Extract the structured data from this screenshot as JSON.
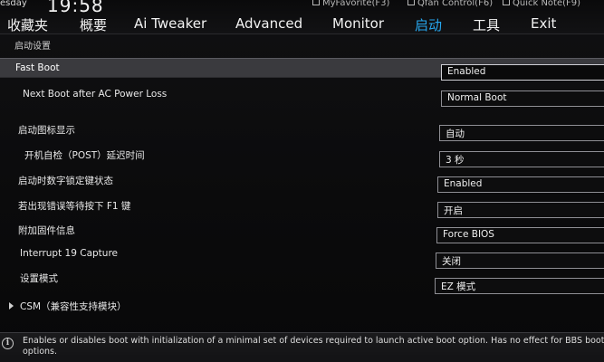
{
  "header": {
    "day": "esday",
    "time": "19:58",
    "hotkeys": [
      "MyFavorite(F3)",
      "Qfan Control(F6)",
      "Quick Note(F9)"
    ],
    "tabs": [
      {
        "label": "收藏夹",
        "active": false
      },
      {
        "label": "概要",
        "active": false
      },
      {
        "label": "Ai Tweaker",
        "active": false
      },
      {
        "label": "Advanced",
        "active": false
      },
      {
        "label": "Monitor",
        "active": false
      },
      {
        "label": "启动",
        "active": true
      },
      {
        "label": "工具",
        "active": false
      },
      {
        "label": "Exit",
        "active": false
      }
    ]
  },
  "section": {
    "title": "启动设置"
  },
  "settings": [
    {
      "label": "Fast Boot",
      "value": "Enabled"
    },
    {
      "label": "Next Boot after AC Power Loss",
      "value": "Normal Boot"
    },
    {
      "label": "启动图标显示",
      "value": "自动"
    },
    {
      "label": "开机自检（POST）延迟时间",
      "value": "3 秒"
    },
    {
      "label": "启动时数字锁定键状态",
      "value": "Enabled"
    },
    {
      "label": "若出现错误等待按下 F1 键",
      "value": "开启"
    },
    {
      "label": "附加固件信息",
      "value": "Force BIOS"
    },
    {
      "label": "Interrupt 19 Capture",
      "value": "关闭"
    },
    {
      "label": "设置模式",
      "value": "EZ 模式"
    },
    {
      "label": "CSM（兼容性支持模块）",
      "value": ""
    }
  ],
  "help": {
    "text": "Enables or disables boot with initialization of a minimal set of devices required to launch active boot option. Has no effect for BBS boot options."
  },
  "colors": {
    "accent": "#27a8f0",
    "highlight_row": "#3a3a3e",
    "background": "#0b0a0b"
  }
}
